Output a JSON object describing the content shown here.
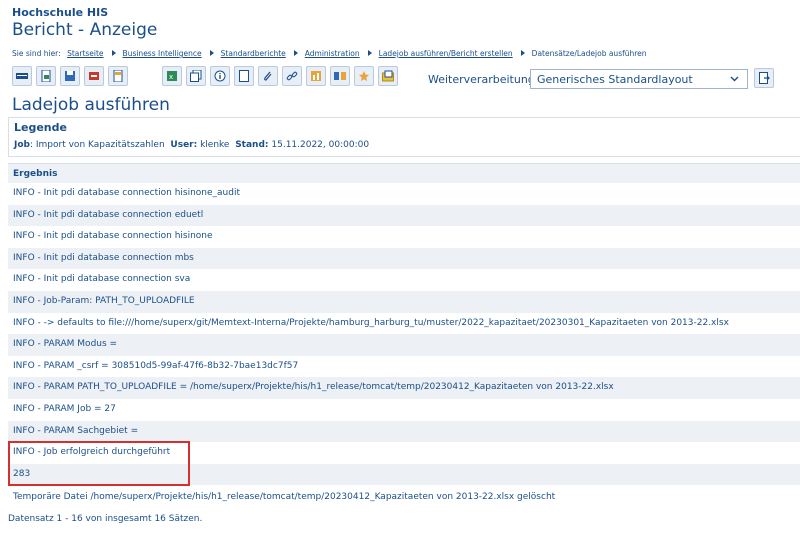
{
  "header": {
    "university": "Hochschule HIS",
    "title": "Bericht - Anzeige"
  },
  "breadcrumb": {
    "prefix": "Sie sind hier:",
    "items": [
      "Startseite",
      "Business Intelligence",
      "Standardberichte",
      "Administration",
      "Ladejob ausführen/Bericht erstellen"
    ],
    "current": "Datensätze/Ladejob ausführen"
  },
  "toolbar": {
    "icons": [
      "table-icon",
      "export-icon",
      "save-icon",
      "pdf-icon",
      "image-icon",
      "excel-icon",
      "copy-icon",
      "info-icon",
      "page-icon",
      "attachment-icon",
      "link-icon",
      "chart-icon",
      "compare-icon",
      "star-icon",
      "folder-icon"
    ],
    "weiterverarbeitung_label": "Weiterverarbeitung:",
    "layout_value": "Generisches Standardlayout",
    "go_icon": "go-icon"
  },
  "section_title": "Ladejob ausführen",
  "legend": {
    "title": "Legende",
    "job_label": "Job",
    "job_value": ": Import von Kapazitätszahlen",
    "user_label": "User:",
    "user_value": " klenke",
    "stand_label": "Stand:",
    "stand_value": " 15.11.2022, 00:00:00"
  },
  "results": {
    "header": "Ergebnis",
    "rows": [
      "INFO - Init pdi database connection hisinone_audit",
      "INFO - Init pdi database connection eduetl",
      "INFO - Init pdi database connection hisinone",
      "INFO - Init pdi database connection mbs",
      "INFO - Init pdi database connection sva",
      "INFO - Job-Param: PATH_TO_UPLOADFILE",
      "INFO - -> defaults to file:///home/superx/git/Memtext-Interna/Projekte/hamburg_harburg_tu/muster/2022_kapazitaet/20230301_Kapazitaeten von 2013-22.xlsx",
      "INFO - PARAM Modus =",
      "INFO - PARAM _csrf = 308510d5-99af-47f6-8b32-7bae13dc7f57",
      "INFO - PARAM PATH_TO_UPLOADFILE = /home/superx/Projekte/his/h1_release/tomcat/temp/20230412_Kapazitaeten von 2013-22.xlsx",
      "INFO - PARAM Job = 27",
      "INFO - PARAM Sachgebiet =",
      "INFO - Job erfolgreich durchgeführt",
      "283"
    ]
  },
  "temp_file_message": "Temporäre Datei /home/superx/Projekte/his/h1_release/tomcat/temp/20230412_Kapazitaeten von 2013-22.xlsx gelöscht",
  "record_count": "Datensatz 1 - 16 von insgesamt 16 Sätzen."
}
